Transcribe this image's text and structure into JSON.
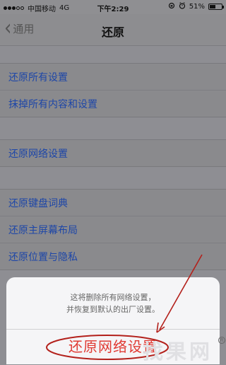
{
  "status_bar": {
    "carrier": "中国移动",
    "network": "4G",
    "time": "下午2:29",
    "battery_percent": "51%",
    "battery_level": 0.51
  },
  "nav": {
    "back_label": "通用",
    "title": "还原"
  },
  "groups": [
    {
      "items": [
        "还原所有设置",
        "抹掉所有内容和设置"
      ]
    },
    {
      "items": [
        "还原网络设置"
      ]
    },
    {
      "items": [
        "还原键盘词典",
        "还原主屏幕布局",
        "还原位置与隐私"
      ]
    }
  ],
  "action_sheet": {
    "message_line1": "这将删除所有网络设置，",
    "message_line2": "并恢复到默认的出厂设置。",
    "action_label": "还原网络设置"
  },
  "annotation_color": "#b3201b",
  "watermark": {
    "text": "找果网",
    "badge": "R"
  }
}
